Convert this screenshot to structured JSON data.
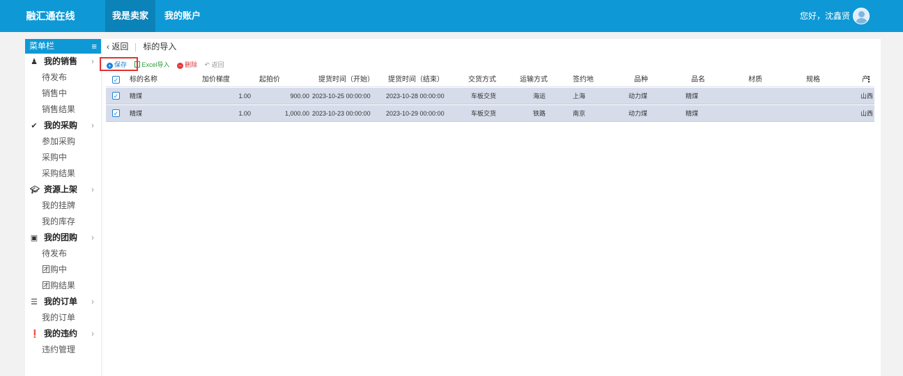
{
  "topbar": {
    "brand": "融汇通在线",
    "tabs": [
      {
        "label": "我是卖家",
        "active": true
      },
      {
        "label": "我的账户",
        "active": false
      }
    ],
    "greeting": "您好，沈鑫贤"
  },
  "sidebar": {
    "title": "菜单栏",
    "groups": [
      {
        "label": "我的销售",
        "icon": "seller-icon",
        "items": [
          "待发布",
          "销售中",
          "销售结果"
        ]
      },
      {
        "label": "我的采购",
        "icon": "check-circle-icon",
        "items": [
          "参加采购",
          "采购中",
          "采购结果"
        ]
      },
      {
        "label": "资源上架",
        "icon": "graduation-cap-icon",
        "items": [
          "我的挂牌",
          "我的库存"
        ]
      },
      {
        "label": "我的团购",
        "icon": "group-buy-icon",
        "items": [
          "待发布",
          "团购中",
          "团购结果"
        ]
      },
      {
        "label": "我的订单",
        "icon": "order-list-icon",
        "items": [
          "我的订单"
        ]
      },
      {
        "label": "我的违约",
        "icon": "exclamation-circle-icon",
        "items": [
          "违约管理"
        ]
      }
    ]
  },
  "breadcrumb": {
    "back": "返回",
    "title": "标的导入"
  },
  "toolbar": {
    "save": "保存",
    "excel": "Excel导入",
    "delete": "删除",
    "ret": "返回"
  },
  "table": {
    "headers": [
      "标的名称",
      "加价梯度",
      "起拍价",
      "提货时间（开始）",
      "提货时间（结束）",
      "交货方式",
      "运输方式",
      "签约地",
      "品种",
      "品名",
      "材质",
      "规格",
      "产"
    ],
    "rows": [
      [
        "精煤",
        "1.00",
        "900.00",
        "2023-10-25 00:00:00",
        "2023-10-28 00:00:00",
        "车板交货",
        "海运",
        "上海",
        "动力煤",
        "精煤",
        "",
        "",
        "山西"
      ],
      [
        "精煤",
        "1.00",
        "1,000.00",
        "2023-10-23 00:00:00",
        "2023-10-29 00:00:00",
        "车板交货",
        "铁路",
        "南京",
        "动力煤",
        "精煤",
        "",
        "",
        "山西"
      ]
    ]
  },
  "colors": {
    "topbar": "#0e99d6",
    "active_tab": "#0b82b8",
    "selected_row": "#d6dcea",
    "highlight_box": "#e53030"
  }
}
